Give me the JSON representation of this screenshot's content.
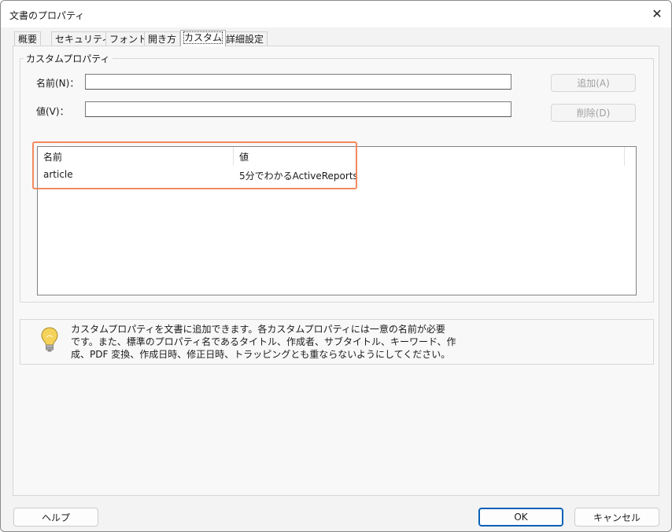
{
  "window": {
    "title": "文書のプロパティ"
  },
  "tabs": [
    {
      "label": "概要"
    },
    {
      "label": "セキュリティ"
    },
    {
      "label": "フォント"
    },
    {
      "label": "開き方"
    },
    {
      "label": "カスタム",
      "active": true
    },
    {
      "label": "詳細設定"
    }
  ],
  "custom": {
    "group_title": "カスタムプロパティ",
    "name_label": "名前(N)：",
    "name_value": "",
    "value_label": "値(V)：",
    "value_value": "",
    "add_button": "追加(A)",
    "delete_button": "削除(D)",
    "list": {
      "columns": [
        "名前",
        "値"
      ],
      "rows": [
        {
          "name": "article",
          "value": "5分でわかるActiveReports"
        }
      ]
    },
    "info_lines": [
      "カスタムプロパティを文書に追加できます。各カスタムプロパティには一意の名前が必要",
      "です。また、標準のプロパティ名であるタイトル、作成者、サブタイトル、キーワード、作",
      "成、PDF 変換、作成日時、修正日時、トラッピングとも重ならないようにしてください。"
    ]
  },
  "footer": {
    "help_button": "ヘルプ",
    "ok_button": "OK",
    "cancel_button": "キャンセル"
  },
  "colors": {
    "highlight": "#f28a5e",
    "default_button_border": "#005fb8",
    "bulb": "#f5d35a"
  }
}
